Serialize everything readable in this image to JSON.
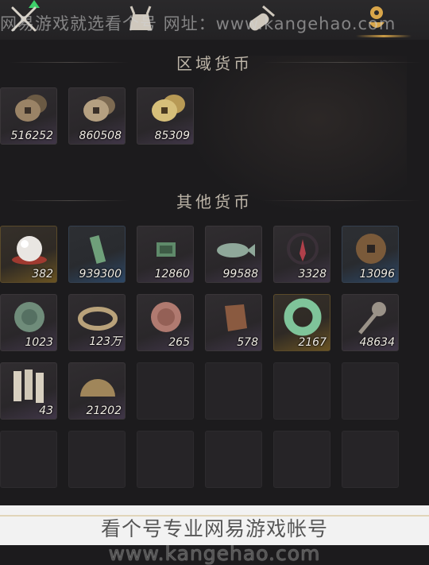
{
  "watermark_top": "网易游戏就选看个号  网址：www.kangehao.com",
  "sections": {
    "regional": {
      "title": "区域货币"
    },
    "other": {
      "title": "其他货币"
    }
  },
  "regional_items": [
    {
      "name": "coin-stack-a-icon",
      "quantity": "516252"
    },
    {
      "name": "coin-stack-b-icon",
      "quantity": "860508"
    },
    {
      "name": "coin-stack-c-icon",
      "quantity": "85309"
    }
  ],
  "other_items": [
    {
      "name": "pearl-icon",
      "quantity": "382"
    },
    {
      "name": "jade-token-icon",
      "quantity": "939300"
    },
    {
      "name": "jade-tablet-icon",
      "quantity": "12860"
    },
    {
      "name": "jade-fish-icon",
      "quantity": "99588"
    },
    {
      "name": "crimson-pendant-icon",
      "quantity": "3328"
    },
    {
      "name": "bronze-coin-icon",
      "quantity": "13096"
    },
    {
      "name": "green-medallion-icon",
      "quantity": "1023"
    },
    {
      "name": "coin-string-icon",
      "quantity": "123万"
    },
    {
      "name": "red-medallion-icon",
      "quantity": "265"
    },
    {
      "name": "bronze-plate-icon",
      "quantity": "578"
    },
    {
      "name": "jade-ring-icon",
      "quantity": "2167"
    },
    {
      "name": "spade-coin-icon",
      "quantity": "48634"
    },
    {
      "name": "bamboo-slips-icon",
      "quantity": "43"
    },
    {
      "name": "half-coin-icon",
      "quantity": "21202"
    }
  ],
  "footer_watermark": "看个号专业网易游戏帐号 www.kangehao.com",
  "colors": {
    "accent_green": "#3ecf6a",
    "gold_tab": "#c99a45",
    "quantity_text": "#f0ece4"
  }
}
